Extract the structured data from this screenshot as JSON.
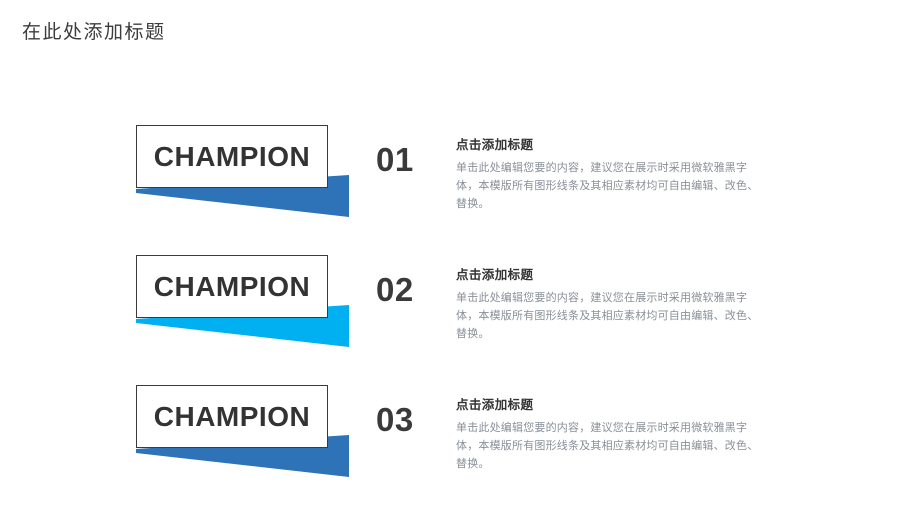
{
  "slide": {
    "title": "在此处添加标题",
    "background_color": "#ffffff"
  },
  "colors": {
    "wedge_dark_blue": "#2e72b8",
    "wedge_cyan_blue": "#00b0f0",
    "box_border": "#3a3a3a",
    "champion_text": "#333333",
    "index_number": "#3a3a3a",
    "heading_text": "#333333",
    "body_text": "#8a8f99",
    "title_text": "#3c3c3c"
  },
  "rows": [
    {
      "badge_label": "CHAMPION",
      "index": "01",
      "wedge_color": "#2e72b8",
      "heading": "点击添加标题",
      "body": "单击此处编辑您要的内容，建议您在展示时采用微软雅黑字体，本模版所有图形线条及其相应素材均可自由编辑、改色、替换。"
    },
    {
      "badge_label": "CHAMPION",
      "index": "02",
      "wedge_color": "#00b0f0",
      "heading": "点击添加标题",
      "body": "单击此处编辑您要的内容，建议您在展示时采用微软雅黑字体，本模版所有图形线条及其相应素材均可自由编辑、改色、替换。"
    },
    {
      "badge_label": "CHAMPION",
      "index": "03",
      "wedge_color": "#2e72b8",
      "heading": "点击添加标题",
      "body": "单击此处编辑您要的内容，建议您在展示时采用微软雅黑字体，本模版所有图形线条及其相应素材均可自由编辑、改色、替换。"
    }
  ]
}
